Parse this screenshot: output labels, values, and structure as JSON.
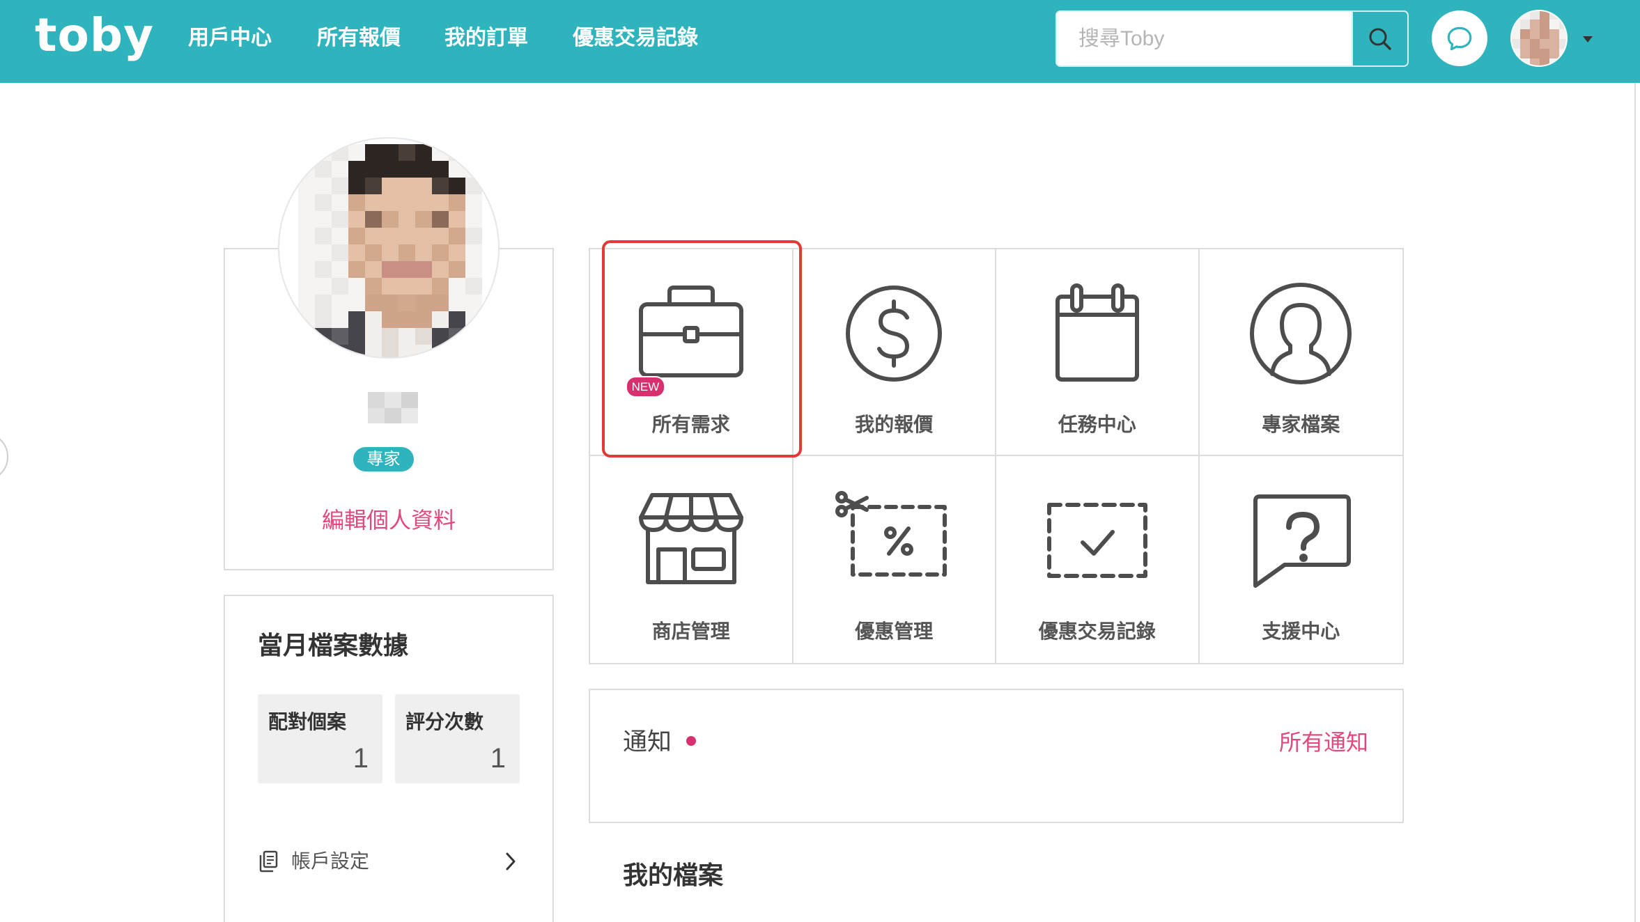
{
  "app": {
    "logo_text": "toby"
  },
  "nav": {
    "items": [
      {
        "label": "用戶中心"
      },
      {
        "label": "所有報價"
      },
      {
        "label": "我的訂單"
      },
      {
        "label": "優惠交易記錄"
      }
    ]
  },
  "search": {
    "placeholder": "搜尋Toby",
    "button_icon": "search-icon"
  },
  "header": {
    "chat_icon": "chat-bubble-icon",
    "avatar": "user-avatar",
    "menu_icon": "caret-down-icon"
  },
  "profile": {
    "role_badge": "專家",
    "edit_link": "編輯個人資料"
  },
  "stats": {
    "title": "當月檔案數據",
    "items": [
      {
        "label": "配對個案",
        "value": 1
      },
      {
        "label": "評分次數",
        "value": 1
      }
    ]
  },
  "account_menu": {
    "items": [
      {
        "label": "帳戶設定",
        "icon": "document-icon",
        "trailing_icon": "chevron-right-icon"
      }
    ]
  },
  "tiles": [
    {
      "label": "所有需求",
      "icon": "briefcase-icon",
      "badge": "NEW"
    },
    {
      "label": "我的報價",
      "icon": "dollar-circle-icon"
    },
    {
      "label": "任務中心",
      "icon": "calendar-icon"
    },
    {
      "label": "專家檔案",
      "icon": "user-profile-icon"
    },
    {
      "label": "商店管理",
      "icon": "store-icon"
    },
    {
      "label": "優惠管理",
      "icon": "coupon-icon"
    },
    {
      "label": "優惠交易記錄",
      "icon": "dashed-check-icon"
    },
    {
      "label": "支援中心",
      "icon": "help-bubble-icon"
    }
  ],
  "highlight": {
    "tile_index": 0,
    "color": "#e53935"
  },
  "notifications": {
    "title": "通知",
    "unread_indicator": true,
    "view_all_link": "所有通知"
  },
  "my_profile_section": {
    "title": "我的檔案"
  },
  "colors": {
    "brand_teal": "#2fb3bd",
    "link_pink": "#e2487d",
    "badge_crimson": "#d7306f",
    "icon_gray": "#4d4d4d"
  }
}
